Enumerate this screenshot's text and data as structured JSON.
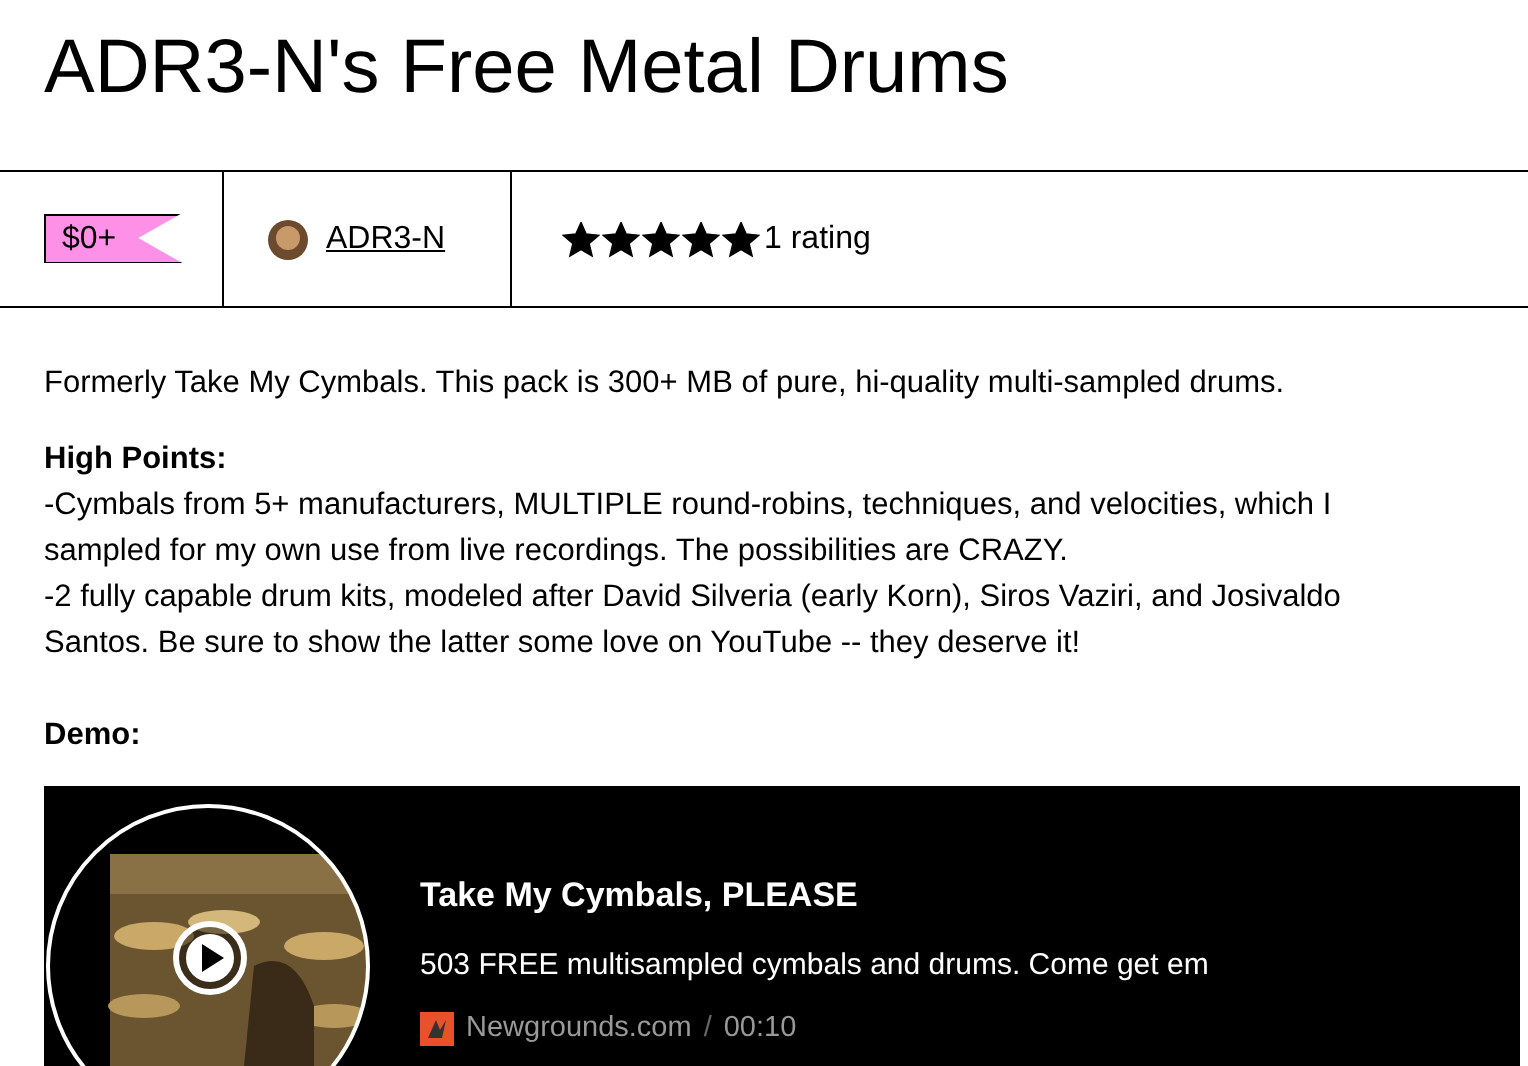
{
  "title": "ADR3-N's Free Metal Drums",
  "price": "$0+",
  "author": {
    "name": "ADR3-N"
  },
  "rating": {
    "stars": 5,
    "label": "1 rating"
  },
  "description": [
    {
      "kind": "para",
      "text": "Formerly Take My Cymbals. This pack is 300+ MB of pure, hi-quality multi-sampled drums."
    },
    {
      "kind": "heading",
      "text": "High Points:",
      "lines": [
        "-Cymbals from 5+ manufacturers, MULTIPLE round-robins, techniques, and velocities, which I sampled for my own use from live recordings. The possibilities are CRAZY.",
        "-2 fully capable drum kits, modeled after David Silveria (early Korn), Siros Vaziri, and Josivaldo Santos. Be sure to show the latter some love on YouTube -- they deserve it!"
      ]
    },
    {
      "kind": "heading",
      "text": "Demo:"
    }
  ],
  "embed": {
    "title": "Take My Cymbals, PLEASE",
    "subtitle": "503 FREE multisampled cymbals and drums. Come get em",
    "source": "Newgrounds.com",
    "separator": "/",
    "duration": "00:10"
  }
}
